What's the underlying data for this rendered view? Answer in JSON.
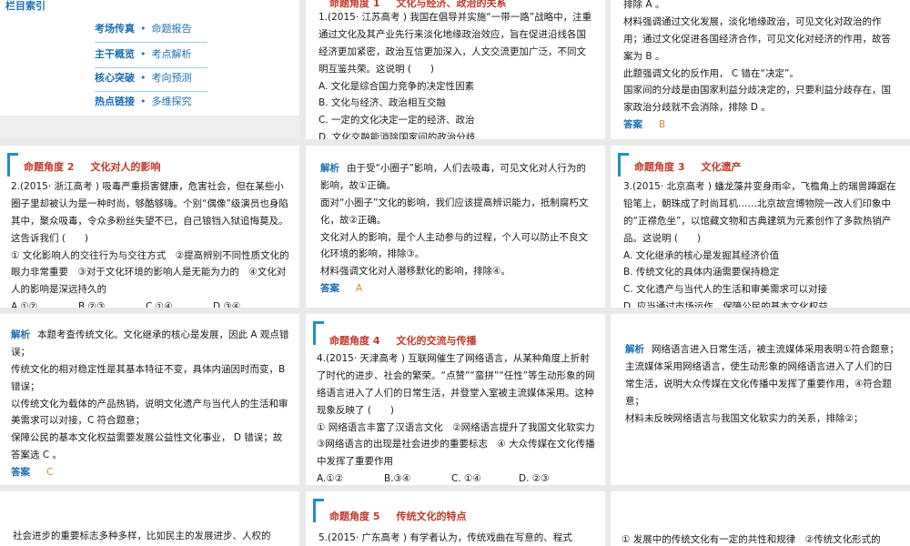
{
  "cards": {
    "menu": {
      "title": "栏目索引",
      "items": [
        {
          "main": "考场传真",
          "sub": "命题报告"
        },
        {
          "main": "主干概览",
          "sub": "考点解析"
        },
        {
          "main": "核心突破",
          "sub": "考向预测"
        },
        {
          "main": "热点链接",
          "sub": "多维探究"
        }
      ]
    },
    "q1": {
      "heading_num": "命题角度 1",
      "heading_title": "文化与经济、政治的关系",
      "stem": "1.(2015· 江苏高考 ) 我国在倡导并实施“一带一路”战略中，注重通过文化及其产业先行来淡化地缘政治效应，旨在促进沿线各国经济更加紧密，政治互信更加深入，人文交流更加广泛，不同文明互鉴共荣。这说明 (　　)",
      "options": [
        "A. 文化是综合国力竞争的决定性因素",
        "B. 文化与经济、政治相互交融",
        "C. 一定的文化决定一定的经济、政治",
        "D. 文化交融能消除国家间的政治分歧"
      ]
    },
    "a1": {
      "lines": [
        "排除 A 。",
        "材料强调通过文化发展，淡化地缘政治，可见文化对政治的作用；通过文化促进各国经济合作，可见文化对经济的作用，故答案为 B 。",
        "此题强调文化的反作用， C 错在“决定”。",
        "国家间的分歧是由国家利益分歧决定的，只要利益分歧存在，国家政治分歧就不会消除，排除 D 。"
      ],
      "answer_label": "答案",
      "answer": "B"
    },
    "q2": {
      "heading_num": "命题角度 2",
      "heading_title": "文化对人的影响",
      "stem": "2.(2015· 浙江高考 ) 吸毒严重损害健康，危害社会，但在某些小圈子里却被认为是一种时尚，够酷够嗨。个别“偶像”级演员也身陷其中，聚众吸毒，令众多粉丝失望不已，自己锒铛入狱追悔莫及。这告诉我们 (　　)",
      "statements": "① 文化影响人的交往行为与交往方式　②提高辨别不同性质文化的眼力非常重要　③对于文化环境的影响人是无能为力的　④文化对人的影响是深远持久的",
      "options": [
        "A.①②",
        "B.②③",
        "C.①④",
        "D.③④"
      ]
    },
    "a2": {
      "label": "解析",
      "lines": [
        "由于受“小圈子”影响，人们去吸毒，可见文化对人行为的影响，故①正确。",
        "面对“小圈子”文化的影响，我们应该提高辨识能力，抵制腐朽文化，故②正确。",
        "文化对人的影响，是个人主动参与的过程，个人可以防止不良文化环境的影响，排除③。",
        "材料强调文化对人潜移默化的影响，排除④。"
      ],
      "answer_label": "答案",
      "answer": "A"
    },
    "q3": {
      "heading_num": "命题角度 3",
      "heading_title": "文化遗产",
      "stem": "3.(2015· 北京高考 ) 蟠龙藻井变身雨伞，飞檐角上的瑞兽蹲踞在铅笔上，朝珠成了时尚耳机……北京故宫博物院一改人们印象中的“正襟危坐”，以馆藏文物和古典建筑为元素创作了多款热销产品。这说明 (　　)",
      "options": [
        "A. 文化继承的核心是发掘其经济价值",
        "B. 传统文化的具体内涵需要保持稳定",
        "C. 文化遗产与当代人的生活和审美需求可以对接",
        "D. 应当通过市场运作，保障公民的基本文化权益"
      ]
    },
    "a3": {
      "label": "解析",
      "lines": [
        "本题考查传统文化。文化继承的核心是发展，因此 A 观点错误；",
        "传统文化的相对稳定性是其基本特征不变，具体内涵因时而变，B 错误；",
        "以传统文化为载体的产品热销，说明文化遗产与当代人的生活和审美需求可以对接，C 符合题意；",
        "保障公民的基本文化权益需要发展公益性文化事业， D 错误；故答案选 C 。"
      ],
      "answer_label": "答案",
      "answer": "C"
    },
    "q4": {
      "heading_num": "命题角度 4",
      "heading_title": "文化的交流与传播",
      "stem": "4.(2015· 天津高考 ) 互联网催生了网络语言，从某种角度上折射了时代的进步、社会的繁荣。“点赞”“蛮拼”“任性”等生动形象的网络语言进入了人们的日常生活，并登堂入室被主流媒体采用。这种现象反映了 (　　)",
      "statements": "① 网络语言丰富了汉语言文化　②网络语言提升了我国文化软实力　③网络语言的出现是社会进步的重要标志　④ 大众传媒在文化传播中发挥了重要作用",
      "options": [
        "A.①②",
        "B.③④",
        "C. ①④",
        "D. ②③"
      ]
    },
    "a4": {
      "label": "解析",
      "lines": [
        "网络语言进入日常生活，被主流媒体采用表明①符合题意；",
        "主流媒体采用网络语言，使生动形象的网络语言进入了人们的日常生活，说明大众传媒在文化传播中发挥了重要作用，④符合题意；",
        "材料未反映网络语言与我国文化软实力的关系，排除②；"
      ]
    },
    "b1": {
      "text": "社会进步的重要标志多种多样，比如民主的发展进步、人权的"
    },
    "q5": {
      "heading_num": "命题角度 5",
      "heading_title": "传统文化的特点",
      "stem": "5.(2015· 广东高考 ) 有学者认为，传统戏曲在写意的、程式"
    },
    "b3": {
      "text": "① 发展中的传统文化有一定的共性和规律　②传统文化形式的"
    }
  }
}
